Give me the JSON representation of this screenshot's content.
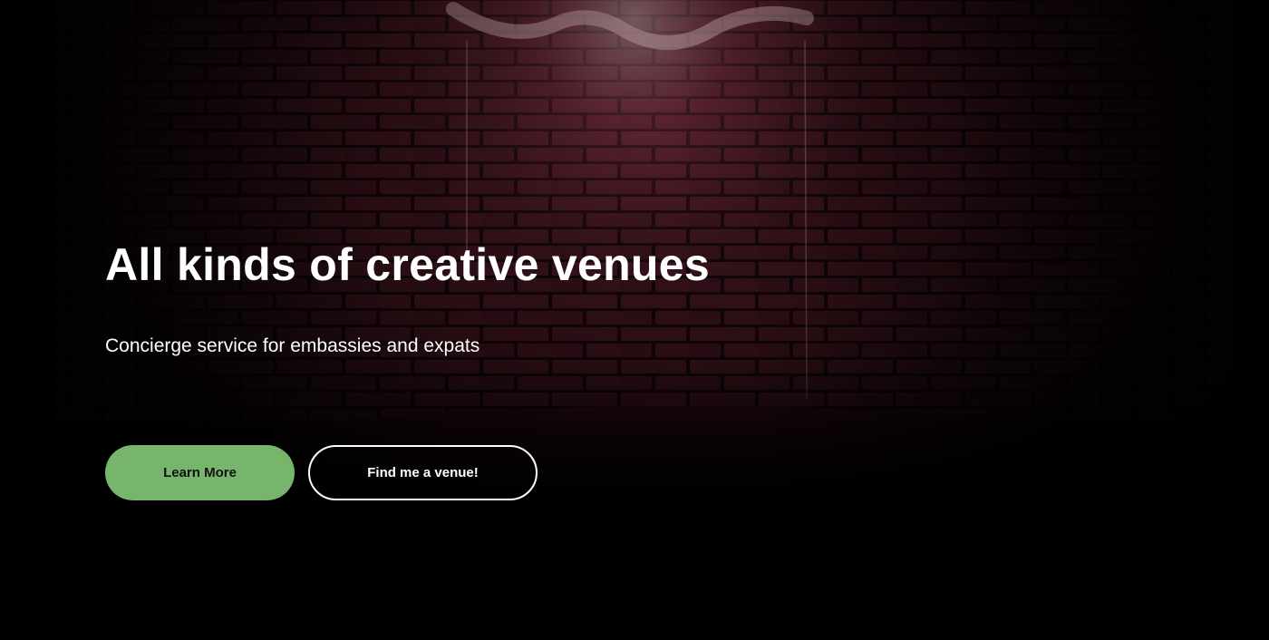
{
  "hero": {
    "background_image": "dark brick wall with neon light and leather sofa",
    "headline": "All kinds of creative venues",
    "subtitle": "Concierge service for embassies and expats",
    "buttons": {
      "learn_more_label": "Learn More",
      "find_venue_label": "Find me a venue!"
    }
  },
  "colors": {
    "primary_button": "#78b56c",
    "outline_button_border": "#ffffff",
    "text": "#ffffff",
    "background_tint": "#5a1a2a"
  }
}
